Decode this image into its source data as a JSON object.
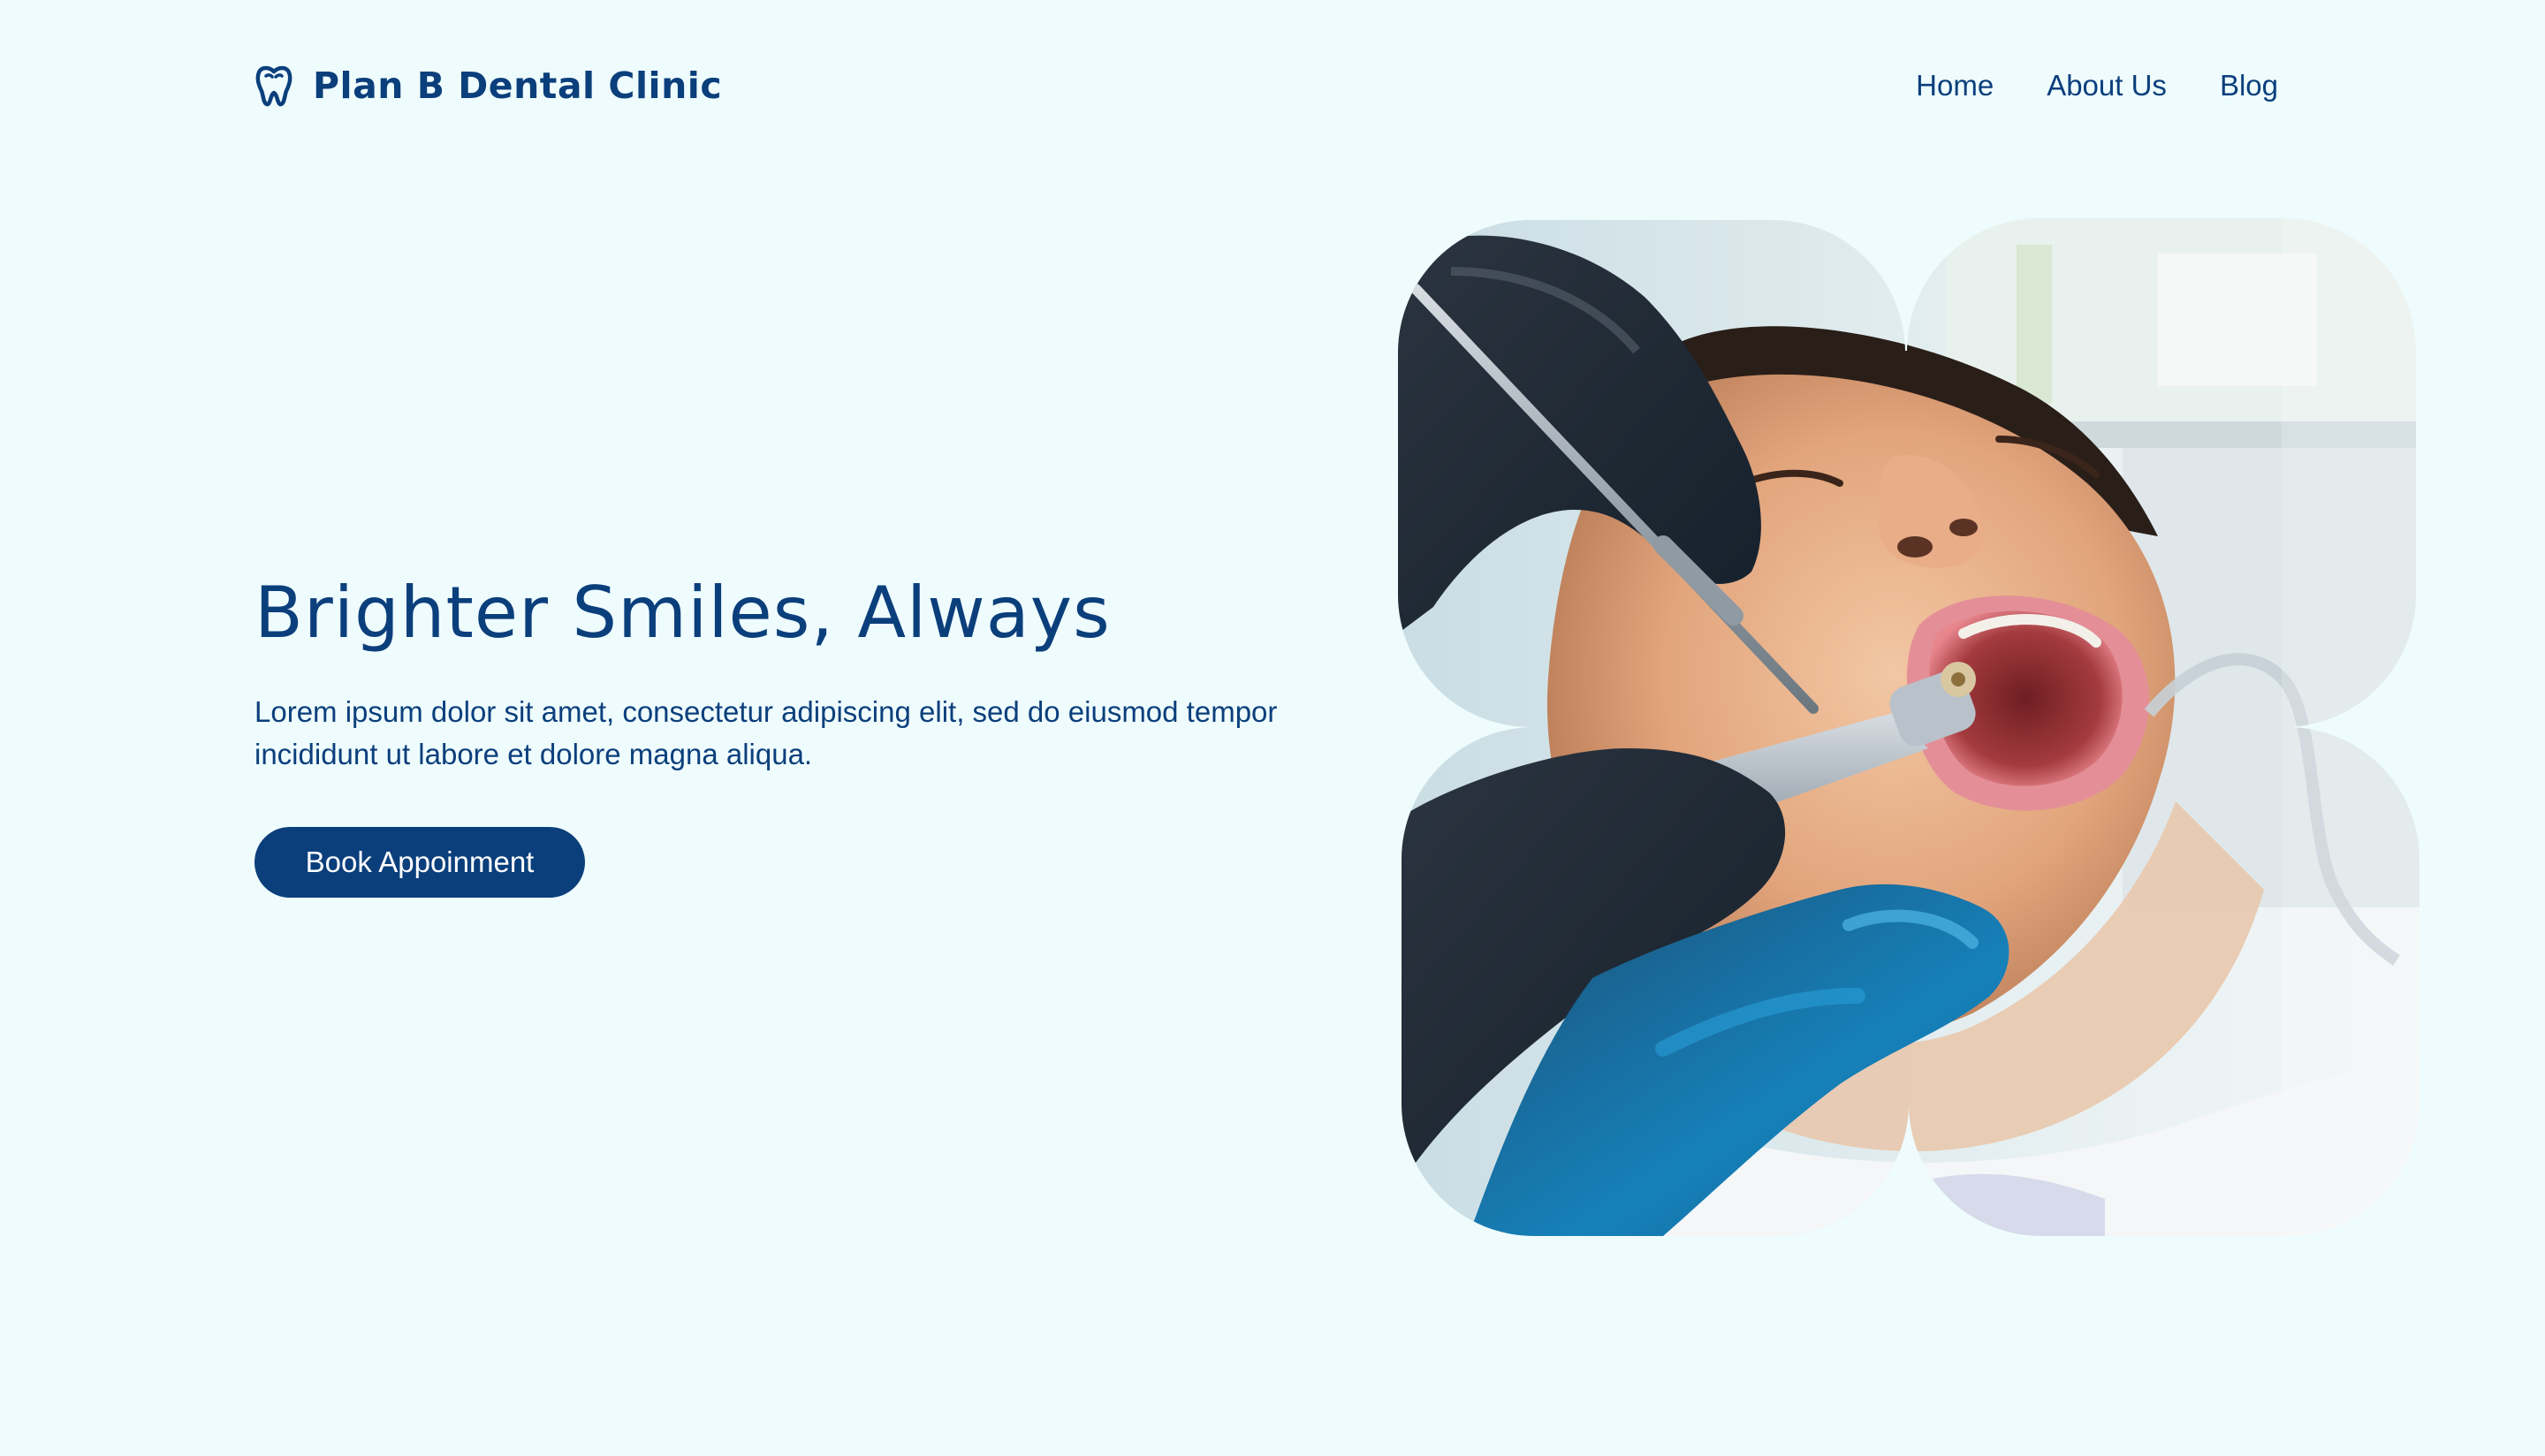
{
  "brand": {
    "name": "Plan B Dental Clinic",
    "icon": "tooth-icon"
  },
  "nav": {
    "items": [
      {
        "label": "Home"
      },
      {
        "label": "About Us"
      },
      {
        "label": "Blog"
      }
    ]
  },
  "hero": {
    "title": "Brighter Smiles, Always",
    "description": "Lorem ipsum dolor sit amet, consectetur adipiscing elit, sed do eiusmod tempor incididunt ut labore et dolore magna aliqua.",
    "cta_label": "Book Appoinment"
  },
  "colors": {
    "background": "#effcfd",
    "primary": "#0b3f7c",
    "button_text": "#ffffff"
  }
}
